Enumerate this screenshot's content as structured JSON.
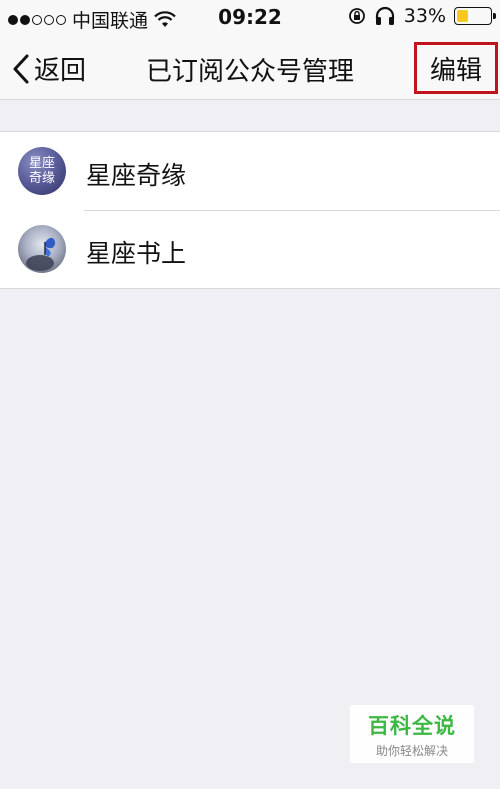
{
  "status_bar": {
    "carrier": "中国联通",
    "time": "09:22",
    "battery_percent": "33%",
    "battery_level": 0.33,
    "battery_color": "#f7c81e",
    "signal_bars_filled": 2,
    "signal_bars_total": 5,
    "icons": [
      "wifi-icon",
      "rotation-lock-icon",
      "headphones-icon",
      "battery-icon"
    ]
  },
  "nav": {
    "back_label": "返回",
    "title": "已订阅公众号管理",
    "edit_label": "编辑",
    "highlight_color": "#c0131c"
  },
  "accounts": [
    {
      "name": "星座奇缘",
      "avatar_text": [
        "星座",
        "奇缘"
      ]
    },
    {
      "name": "星座书上"
    }
  ],
  "watermark": {
    "title": "百科全说",
    "subtitle": "助你轻松解决",
    "color": "#3cb843"
  }
}
